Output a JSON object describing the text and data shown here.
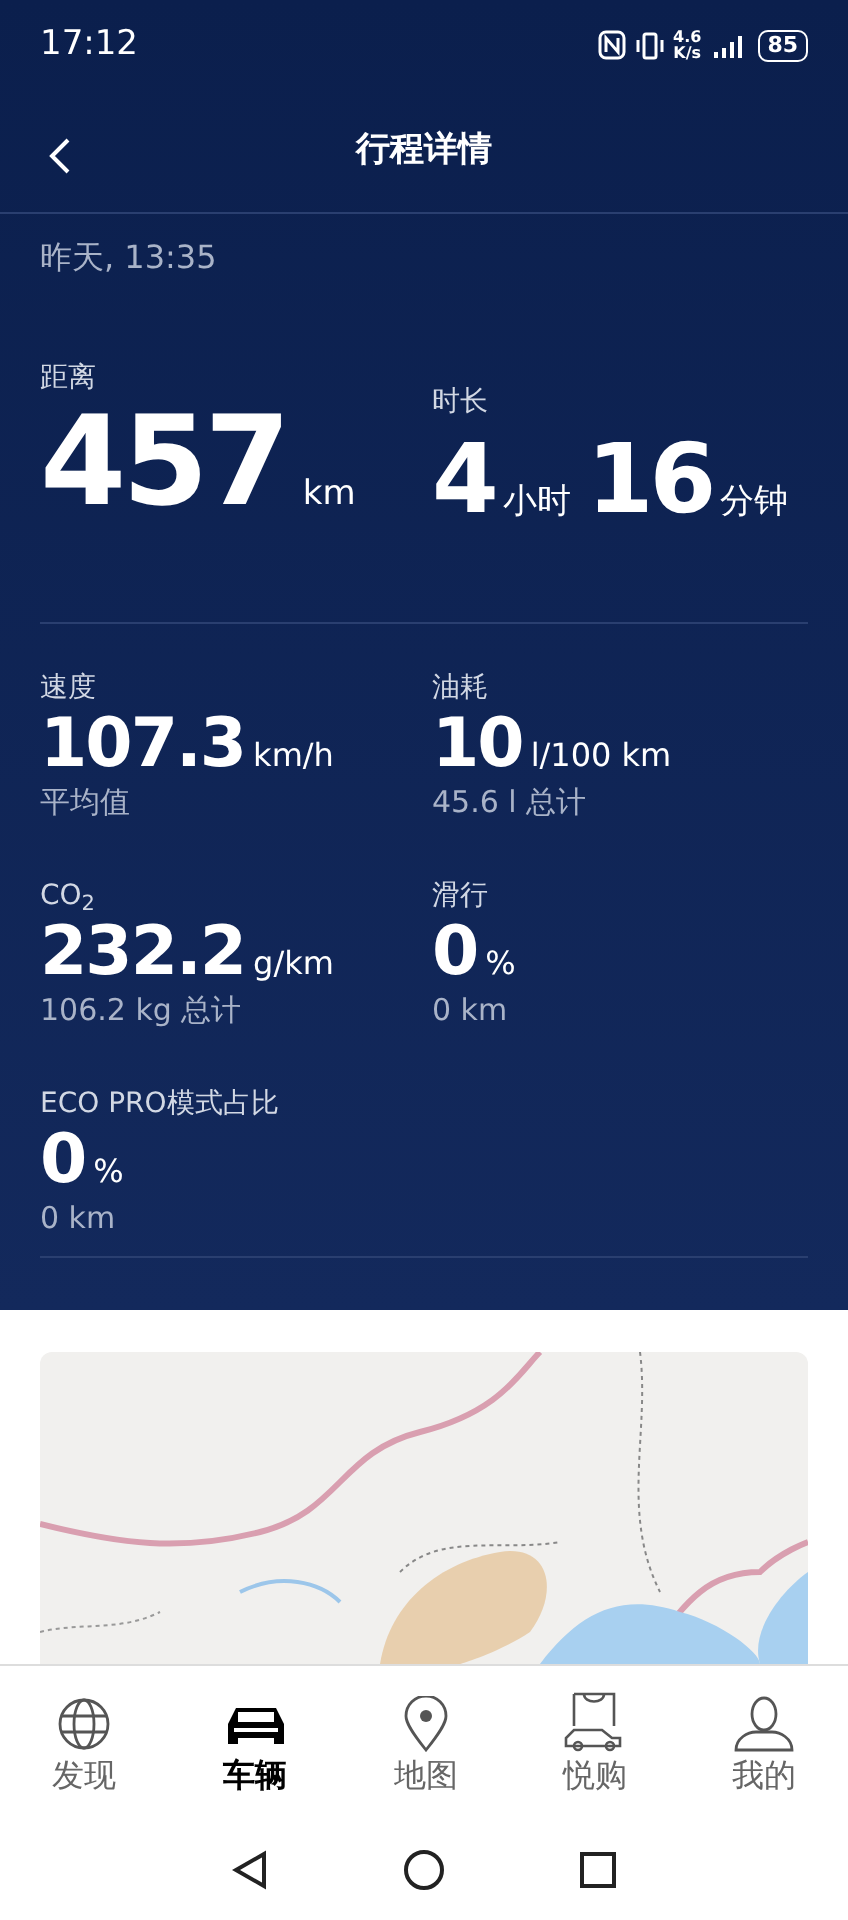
{
  "status_bar": {
    "time": "17:12",
    "speed_value": "4.6",
    "speed_unit": "K/s",
    "battery": "85"
  },
  "header": {
    "title": "行程详情"
  },
  "trip_time": "昨天, 13:35",
  "distance": {
    "label": "距离",
    "value": "457",
    "unit": "km"
  },
  "duration": {
    "label": "时长",
    "hours": "4",
    "hours_unit": "小时",
    "minutes": "16",
    "minutes_unit": "分钟"
  },
  "stats": [
    {
      "label": "速度",
      "value": "107.3",
      "unit": "km/h",
      "note": "平均值"
    },
    {
      "label": "油耗",
      "value": "10",
      "unit": "l/100 km",
      "note": "45.6 l 总计"
    },
    {
      "label": "CO$_{2}$",
      "value": "232.2",
      "unit": "g/km",
      "note": "106.2 kg 总计"
    },
    {
      "label": "滑行",
      "value": "0",
      "unit": "%",
      "note": "0 km"
    },
    {
      "label": "ECO PRO模式占比",
      "value": "0",
      "unit": "%",
      "note": "0 km"
    }
  ],
  "nav": [
    {
      "label": "发现",
      "selected": false
    },
    {
      "label": "车辆",
      "selected": true
    },
    {
      "label": "地图",
      "selected": false
    },
    {
      "label": "悦购",
      "selected": false
    },
    {
      "label": "我的",
      "selected": false
    }
  ]
}
